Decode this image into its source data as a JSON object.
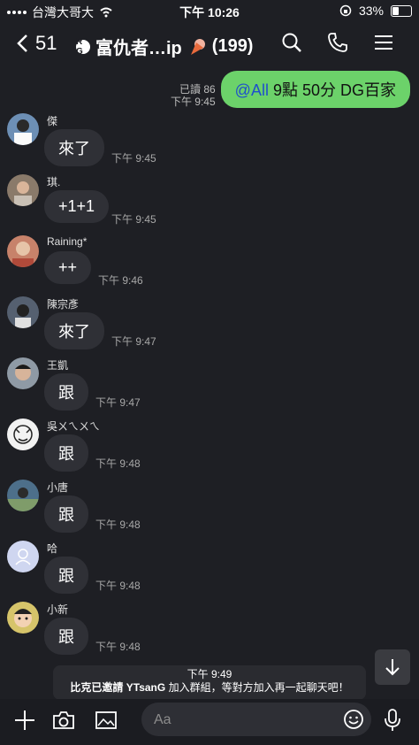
{
  "status_bar": {
    "carrier": "台灣大哥大",
    "time": "下午 10:26",
    "battery_percent": "33%"
  },
  "header": {
    "back_count": "51",
    "group_title": "富仇者…ip",
    "member_count": "(199)",
    "rg_badge": "R G"
  },
  "own_message": {
    "read_receipt": "已讀 86",
    "time": "下午 9:45",
    "mention": "@All",
    "text": " 9點 50分 DG百家"
  },
  "messages": [
    {
      "name": "傑",
      "text": "來了",
      "time": "下午 9:45"
    },
    {
      "name": "琪.",
      "text": "+1+1",
      "time": "下午 9:45"
    },
    {
      "name": "Raining*",
      "text": "++",
      "time": "下午 9:46"
    },
    {
      "name": "陳宗彥",
      "text": "來了",
      "time": "下午 9:47"
    },
    {
      "name": "王凱",
      "text": "跟",
      "time": "下午 9:47"
    },
    {
      "name": "吳ㄨㄟㄨㄟ",
      "text": "跟",
      "time": "下午 9:48"
    },
    {
      "name": "小唐",
      "text": "跟",
      "time": "下午 9:48"
    },
    {
      "name": "哈",
      "text": "跟",
      "time": "下午 9:48"
    },
    {
      "name": "小新",
      "text": "跟",
      "time": "下午 9:48"
    }
  ],
  "system_message": {
    "time": "下午 9:49",
    "text_prefix": "比克已邀請 ",
    "invitee": "YTsanG",
    "text_suffix": " 加入群組，等對方加入再一起聊天吧！"
  },
  "input": {
    "placeholder": "Aa"
  },
  "colors": {
    "background": "#1e1f24",
    "own_bubble": "#6cd26a",
    "incoming_bubble": "#2f3036",
    "mention": "#1e4fcc"
  },
  "avatar_colors": [
    "#6d8fb5",
    "#8a7a6a",
    "#c7826a",
    "#556070",
    "#8f9aa5",
    "#f2f2f2",
    "#4d6f8a",
    "#cfd6f0",
    "#d6c46a"
  ]
}
